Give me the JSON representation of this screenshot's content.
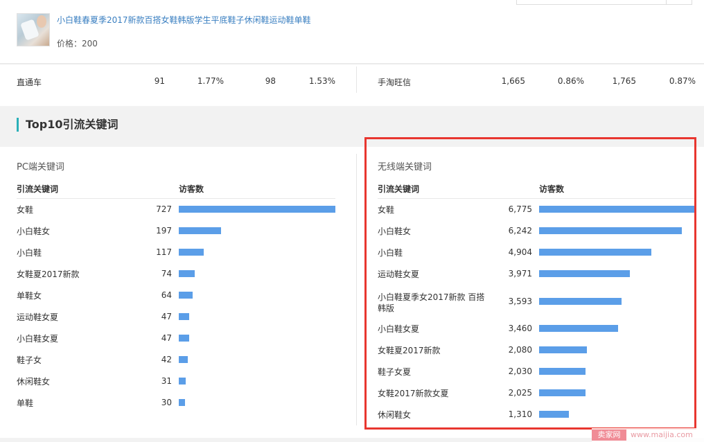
{
  "product": {
    "title": "小白鞋春夏季2017新款百搭女鞋韩版学生平底鞋子休闲鞋运动鞋单鞋",
    "price": "价格：200"
  },
  "channel_row": {
    "left": {
      "name": "直通车",
      "v1": "91",
      "v2": "1.77%",
      "v3": "98",
      "v4": "1.53%"
    },
    "right": {
      "name": "手淘旺信",
      "v1": "1,665",
      "v2": "0.86%",
      "v3": "1,765",
      "v4": "0.87%"
    }
  },
  "section_title": "Top10引流关键词",
  "pc": {
    "title": "PC端关键词",
    "col_keyword": "引流关键词",
    "col_visitors": "访客数",
    "max": 727,
    "rows": [
      {
        "keyword": "女鞋",
        "value": "727",
        "num": 727
      },
      {
        "keyword": "小白鞋女",
        "value": "197",
        "num": 197
      },
      {
        "keyword": "小白鞋",
        "value": "117",
        "num": 117
      },
      {
        "keyword": "女鞋夏2017新款",
        "value": "74",
        "num": 74
      },
      {
        "keyword": "单鞋女",
        "value": "64",
        "num": 64
      },
      {
        "keyword": "运动鞋女夏",
        "value": "47",
        "num": 47
      },
      {
        "keyword": "小白鞋女夏",
        "value": "47",
        "num": 47
      },
      {
        "keyword": "鞋子女",
        "value": "42",
        "num": 42
      },
      {
        "keyword": "休闲鞋女",
        "value": "31",
        "num": 31
      },
      {
        "keyword": "单鞋",
        "value": "30",
        "num": 30
      }
    ]
  },
  "wireless": {
    "title": "无线端关键词",
    "col_keyword": "引流关键词",
    "col_visitors": "访客数",
    "max": 6775,
    "rows": [
      {
        "keyword": "女鞋",
        "value": "6,775",
        "num": 6775
      },
      {
        "keyword": "小白鞋女",
        "value": "6,242",
        "num": 6242
      },
      {
        "keyword": "小白鞋",
        "value": "4,904",
        "num": 4904
      },
      {
        "keyword": "运动鞋女夏",
        "value": "3,971",
        "num": 3971
      },
      {
        "keyword": "小白鞋夏季女2017新款 百搭韩版",
        "value": "3,593",
        "num": 3593
      },
      {
        "keyword": "小白鞋女夏",
        "value": "3,460",
        "num": 3460
      },
      {
        "keyword": "女鞋夏2017新款",
        "value": "2,080",
        "num": 2080
      },
      {
        "keyword": "鞋子女夏",
        "value": "2,030",
        "num": 2030
      },
      {
        "keyword": "女鞋2017新款女夏",
        "value": "2,025",
        "num": 2025
      },
      {
        "keyword": "休闲鞋女",
        "value": "1,310",
        "num": 1310
      }
    ]
  },
  "watermark": {
    "logo": "卖家网",
    "url": "www.maijia.com"
  },
  "colors": {
    "bar": "#5b9ee8",
    "highlight_box": "#e8362f",
    "section_accent": "#2ab0b8",
    "link": "#3a7fc1"
  }
}
